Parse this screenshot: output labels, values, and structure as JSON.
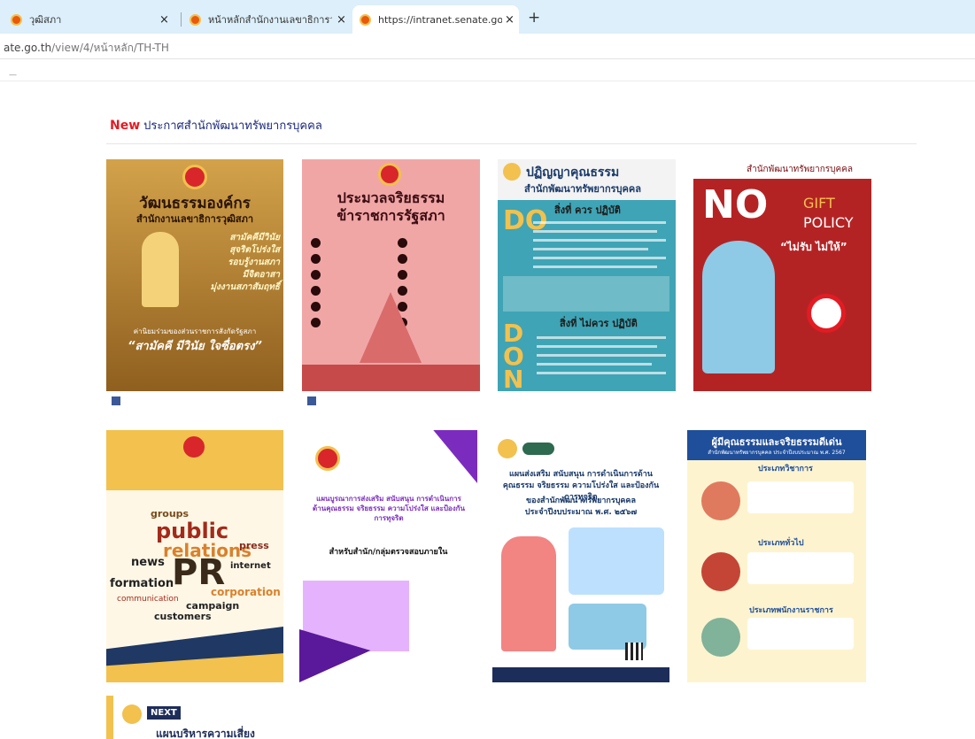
{
  "browser": {
    "tabs": [
      {
        "title": "วุฒิสภา",
        "active": false
      },
      {
        "title": "หน้าหลักสำนักงานเลขาธิการวุฒิสภา",
        "active": false
      },
      {
        "title": "https://intranet.senate.go.th/view",
        "active": true
      }
    ],
    "url_main": "ate.go.th",
    "url_path": "/view/4/หน้าหลัก/TH-TH",
    "new_tab_symbol": "+",
    "close_symbol": "×"
  },
  "page": {
    "tiny_text": "—",
    "section": {
      "new_label": "New",
      "title": "ประกาศสำนักพัฒนาทรัพยากรบุคคล"
    }
  },
  "posters": {
    "p1": {
      "title": "วัฒนธรรมองค์กร",
      "subtitle": "สำนักงานเลขาธิการวุฒิสภา",
      "values": [
        "สามัคคีมีวินัย",
        "สุจริตโปร่งใส",
        "รอบรู้งานสภา",
        "มีจิตอาสา",
        "มุ่งงานสภาสัมฤทธิ์"
      ],
      "slogan_lead": "ค่านิยมร่วมของส่วนราชการสังกัดรัฐสภา",
      "slogan": "“สามัคคี มีวินัย ใจซื่อตรง”"
    },
    "p2": {
      "title": "ประมวลจริยธรรม",
      "subtitle": "ข้าราชการรัฐสภา"
    },
    "p3": {
      "title": "ปฏิญญาคุณธรรม",
      "org": "สำนักพัฒนาทรัพยากรบุคคล",
      "do_head": "สิ่งที่ ควร ปฏิบัติ",
      "dont_head": "สิ่งที่ ไม่ควร ปฏิบัติ",
      "do_letters": "DO",
      "dont_letters": "DONT"
    },
    "p4": {
      "org": "สำนักพัฒนาทรัพยากรบุคคล",
      "no": "NO",
      "gift": "GIFT",
      "policy": "POLICY",
      "slogan": "“ไม่รับ ไม่ให้”"
    },
    "p5": {
      "words": [
        "groups",
        "public",
        "relations",
        "press",
        "news",
        "PR",
        "internet",
        "formation",
        "communication",
        "corporation",
        "campaign",
        "customers"
      ]
    },
    "p6": {
      "headline": "แผนบูรณาการส่งเสริม สนับสนุน การดำเนินการด้านคุณธรรม จริยธรรม ความโปร่งใส และป้องกันการทุจริต",
      "unit": "สำหรับสำนัก/กลุ่มตรวจสอบภายใน"
    },
    "p7": {
      "headline": "แผนส่งเสริม สนับสนุน การดำเนินการด้านคุณธรรม จริยธรรม ความโปร่งใส และป้องกันการทุจริต",
      "org": "ของสำนักพัฒนาทรัพยากรบุคคล",
      "year": "ประจำปีงบประมาณ พ.ศ. ๒๕๖๗"
    },
    "p8": {
      "title": "ผู้มีคุณธรรมและจริยธรรมดีเด่น",
      "subtitle": "สำนักพัฒนาทรัพยากรบุคคล ประจำปีงบประมาณ พ.ศ. 2567",
      "categories": [
        "ประเภทวิชาการ",
        "ประเภททั่วไป",
        "ประเภทพนักงานราชการ"
      ]
    },
    "p9": {
      "brand": "NEXT",
      "title": "แผนบริหารความเสี่ยง"
    }
  },
  "colors": {
    "tabbar": "#dceffa",
    "new_red": "#e31b23",
    "title_blue": "#1b2a7a"
  }
}
